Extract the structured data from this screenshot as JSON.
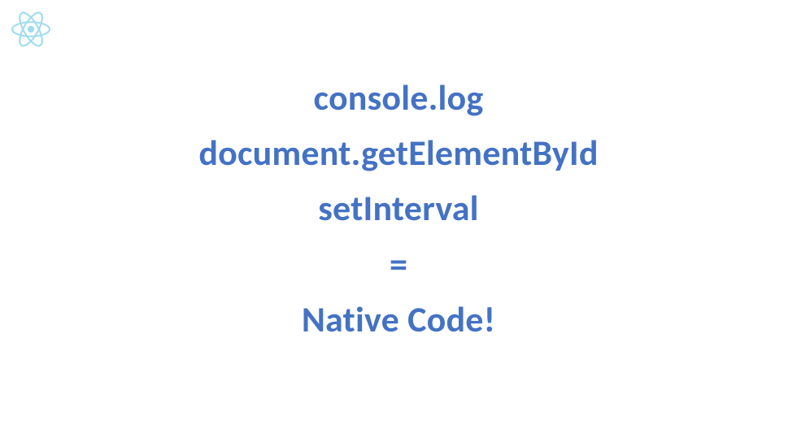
{
  "logo": {
    "name": "react-icon",
    "color": "#9FDBF0"
  },
  "slide": {
    "lines": [
      "console.log",
      "document.getElementById",
      "setInterval",
      "=",
      "Native Code!"
    ],
    "textColor": "#4472C4"
  }
}
